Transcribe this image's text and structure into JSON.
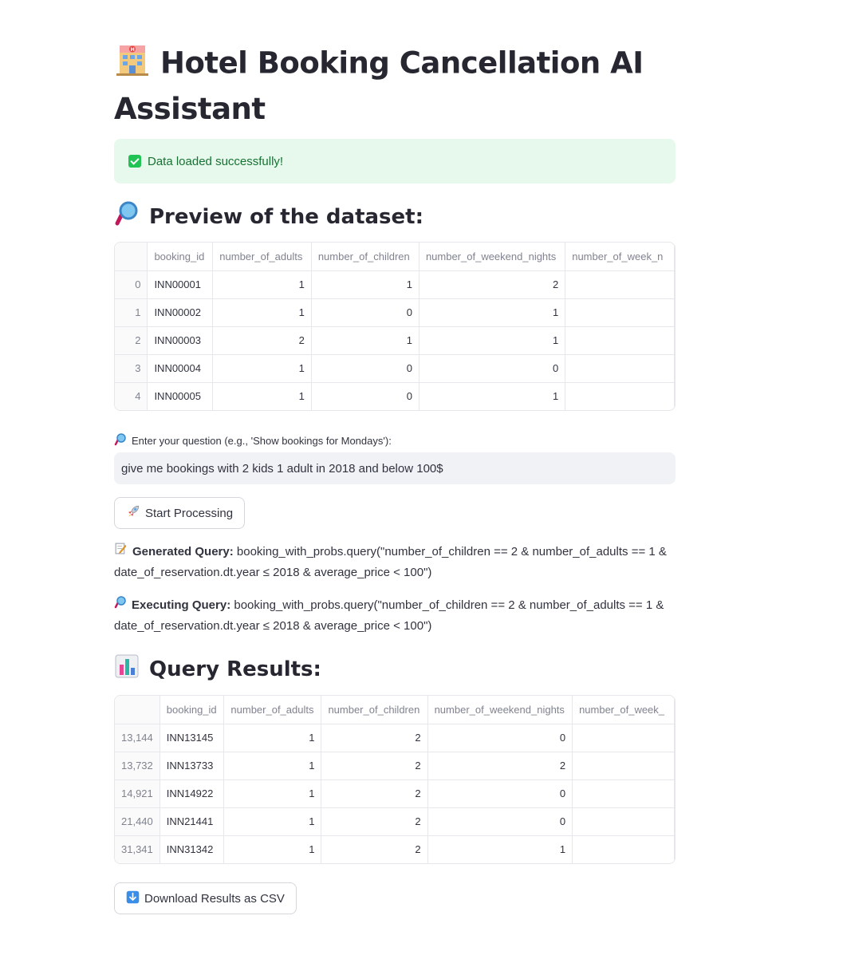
{
  "title": "Hotel Booking Cancellation AI Assistant",
  "icons": {
    "title": "hotel-icon",
    "preview": "magnifier-icon",
    "results": "bar-chart-icon",
    "start": "rocket-icon",
    "download": "down-arrow-icon",
    "generated": "memo-icon",
    "executing": "magnifier-icon"
  },
  "alert": {
    "text": "Data loaded successfully!"
  },
  "preview": {
    "heading": "Preview of the dataset:",
    "columns": [
      "booking_id",
      "number_of_adults",
      "number_of_children",
      "number_of_weekend_nights",
      "number_of_week_n"
    ],
    "rows": [
      {
        "idx": "0",
        "cells": [
          "INN00001",
          "1",
          "1",
          "2",
          ""
        ]
      },
      {
        "idx": "1",
        "cells": [
          "INN00002",
          "1",
          "0",
          "1",
          ""
        ]
      },
      {
        "idx": "2",
        "cells": [
          "INN00003",
          "2",
          "1",
          "1",
          ""
        ]
      },
      {
        "idx": "3",
        "cells": [
          "INN00004",
          "1",
          "0",
          "0",
          ""
        ]
      },
      {
        "idx": "4",
        "cells": [
          "INN00005",
          "1",
          "0",
          "1",
          ""
        ]
      }
    ]
  },
  "question": {
    "label": "Enter your question (e.g., 'Show bookings for Mondays'):",
    "value": "give me bookings with 2 kids 1 adult in 2018 and below 100$"
  },
  "start_button": "Start Processing",
  "generated": {
    "label": "Generated Query:",
    "text": "booking_with_probs.query(\"number_of_children == 2 & number_of_adults == 1 & date_of_reservation.dt.year ≤ 2018 & average_price < 100\")"
  },
  "executing": {
    "label": "Executing Query:",
    "text": "booking_with_probs.query(\"number_of_children == 2 & number_of_adults == 1 & date_of_reservation.dt.year ≤ 2018 & average_price < 100\")"
  },
  "results": {
    "heading": "Query Results:",
    "columns": [
      "booking_id",
      "number_of_adults",
      "number_of_children",
      "number_of_weekend_nights",
      "number_of_week_"
    ],
    "rows": [
      {
        "idx": "13,144",
        "cells": [
          "INN13145",
          "1",
          "2",
          "0",
          ""
        ]
      },
      {
        "idx": "13,732",
        "cells": [
          "INN13733",
          "1",
          "2",
          "2",
          ""
        ]
      },
      {
        "idx": "14,921",
        "cells": [
          "INN14922",
          "1",
          "2",
          "0",
          ""
        ]
      },
      {
        "idx": "21,440",
        "cells": [
          "INN21441",
          "1",
          "2",
          "0",
          ""
        ]
      },
      {
        "idx": "31,341",
        "cells": [
          "INN31342",
          "1",
          "2",
          "1",
          ""
        ]
      }
    ]
  },
  "download_button": "Download Results as CSV"
}
